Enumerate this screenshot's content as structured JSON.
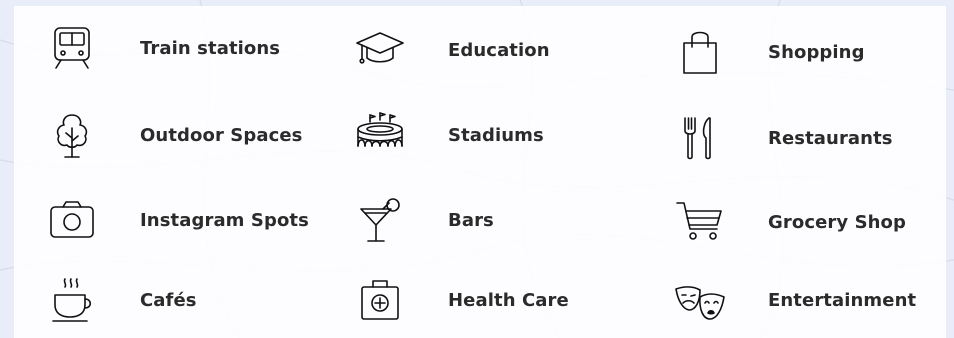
{
  "amenities": [
    {
      "id": "train",
      "label": "Train stations",
      "icon": "train-icon"
    },
    {
      "id": "education",
      "label": "Education",
      "icon": "graduation-cap-icon"
    },
    {
      "id": "shopping",
      "label": "Shopping",
      "icon": "shopping-bag-icon"
    },
    {
      "id": "outdoor",
      "label": "Outdoor Spaces",
      "icon": "tree-icon"
    },
    {
      "id": "stadiums",
      "label": "Stadiums",
      "icon": "stadium-icon"
    },
    {
      "id": "restaurants",
      "label": "Restaurants",
      "icon": "fork-knife-icon"
    },
    {
      "id": "instagram",
      "label": "Instagram Spots",
      "icon": "camera-icon"
    },
    {
      "id": "bars",
      "label": "Bars",
      "icon": "cocktail-icon"
    },
    {
      "id": "grocery",
      "label": "Grocery Shop",
      "icon": "shopping-cart-icon"
    },
    {
      "id": "cafes",
      "label": "Cafés",
      "icon": "coffee-cup-icon"
    },
    {
      "id": "health",
      "label": "Health Care",
      "icon": "first-aid-kit-icon"
    },
    {
      "id": "entertainment",
      "label": "Entertainment",
      "icon": "theater-masks-icon"
    }
  ],
  "colors": {
    "text": "#2b2b2b",
    "icon_stroke": "#111111",
    "background": "#e9edf9",
    "panel": "#ffffff"
  }
}
